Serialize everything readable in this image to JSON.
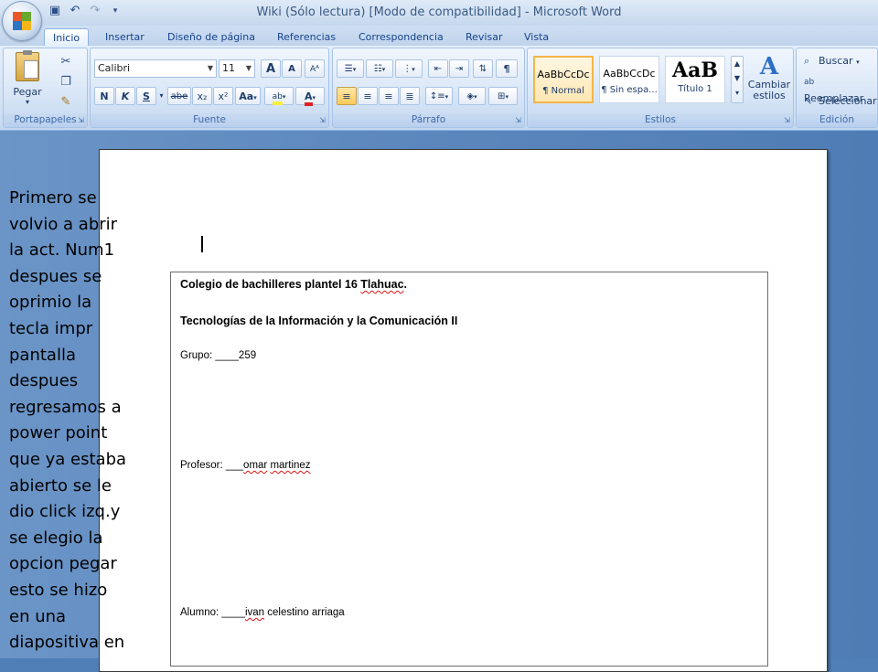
{
  "window": {
    "title": "Wiki (Sólo lectura) [Modo de compatibilidad] - Microsoft Word"
  },
  "quick_access": {
    "icons": [
      "save-icon",
      "undo-icon",
      "redo-icon",
      "customize-icon"
    ]
  },
  "tabs": [
    "Inicio",
    "Insertar",
    "Diseño de página",
    "Referencias",
    "Correspondencia",
    "Revisar",
    "Vista"
  ],
  "active_tab": "Inicio",
  "ribbon": {
    "portapapeles": {
      "label": "Portapapeles",
      "paste_label": "Pegar"
    },
    "fuente": {
      "label": "Fuente",
      "font_name": "Calibri",
      "font_size": "11",
      "grow_font": "A",
      "shrink_font": "A",
      "bold": "N",
      "italic": "K",
      "underline": "S",
      "strikethrough": "abe",
      "subscript": "x₂",
      "superscript": "x²",
      "change_case": "Aa",
      "highlight_color": "#f7f03a",
      "font_color": "#e02020"
    },
    "parrafo": {
      "label": "Párrafo",
      "show_marks": "¶"
    },
    "estilos": {
      "label": "Estilos",
      "items": [
        {
          "sample": "AaBbCcDc",
          "name": "¶ Normal"
        },
        {
          "sample": "AaBbCcDc",
          "name": "¶ Sin espa..."
        },
        {
          "sample": "AaB",
          "name": "Título 1"
        }
      ],
      "change_styles": "Cambiar\nestilos"
    },
    "edicion": {
      "label": "Edición",
      "find": "Buscar",
      "replace": "Reemplazar",
      "select": "Seleccionar"
    }
  },
  "document": {
    "inner": {
      "school": "Colegio de bachilleres plantel 16 ",
      "school_misspelled": "Tlahuac",
      "school_end": ".",
      "subject": "Tecnologías de la Información y la Comunicación II",
      "group": "Grupo: ____259",
      "teacher_prefix": "Profesor: ___",
      "teacher_name_a": "omar",
      "teacher_name_b": " ",
      "teacher_name_c": "martinez",
      "student_prefix": "Alumno: ____",
      "student_name_a": "ivan",
      "student_name_b": " celestino arriaga"
    }
  },
  "overlay_text": [
    "Primero se",
    "volvio a abrir",
    "la act. Num1",
    "despues se",
    "oprimio la",
    "tecla impr",
    "pantalla",
    "despues",
    "regresamos a",
    "power point",
    "que ya estaba",
    "abierto se le",
    "dio click izq.y",
    "se elegio la",
    "opcion pegar",
    "esto se hizo",
    "en una",
    "diapositiva en"
  ]
}
